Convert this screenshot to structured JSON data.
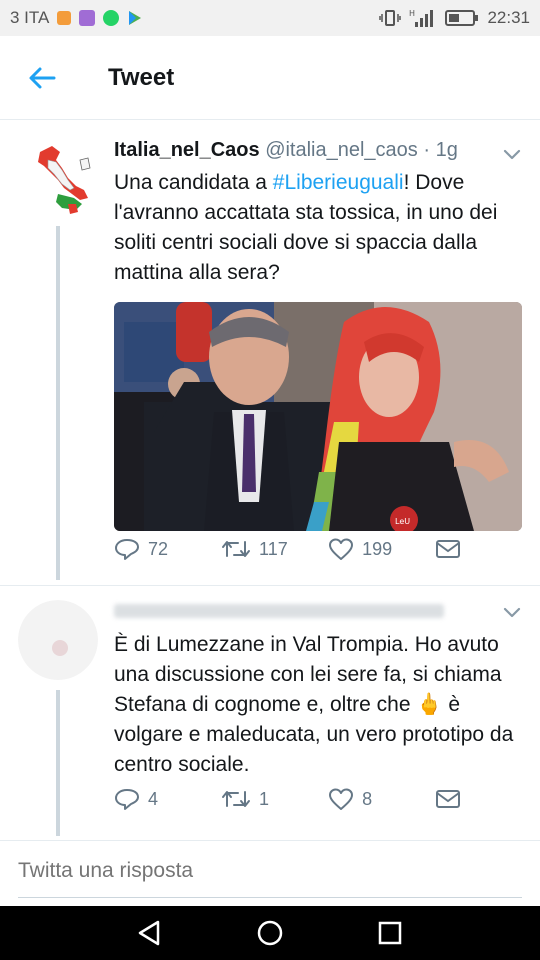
{
  "status_bar": {
    "carrier": "3 ITA",
    "time": "22:31"
  },
  "header": {
    "title": "Tweet",
    "back_icon": "arrow-left-icon",
    "accent_color": "#1da1f2"
  },
  "tweet_main": {
    "display_name": "Italia_nel_Caos",
    "handle": "@italia_nel_caos",
    "separator": "·",
    "time": "1g",
    "text_before": "Una candidata a ",
    "hashtag": "#Liberieuguali",
    "text_after": "! Dove l'avranno accattata sta tossica, in uno dei soliti centri sociali dove si spaccia dalla mattina alla sera?",
    "replies": "72",
    "retweets": "117",
    "likes": "199"
  },
  "tweet_reply": {
    "text_before": "È di Lumezzane in Val Trompia. Ho avuto una discussione con lei sere fa, si chiama Stefana di cognome e, oltre che ",
    "emoji": "🖕",
    "text_after": " è volgare e maleducata, un vero prototipo da centro sociale.",
    "replies": "4",
    "retweets": "1",
    "likes": "8"
  },
  "compose": {
    "placeholder": "Twitta una risposta"
  }
}
